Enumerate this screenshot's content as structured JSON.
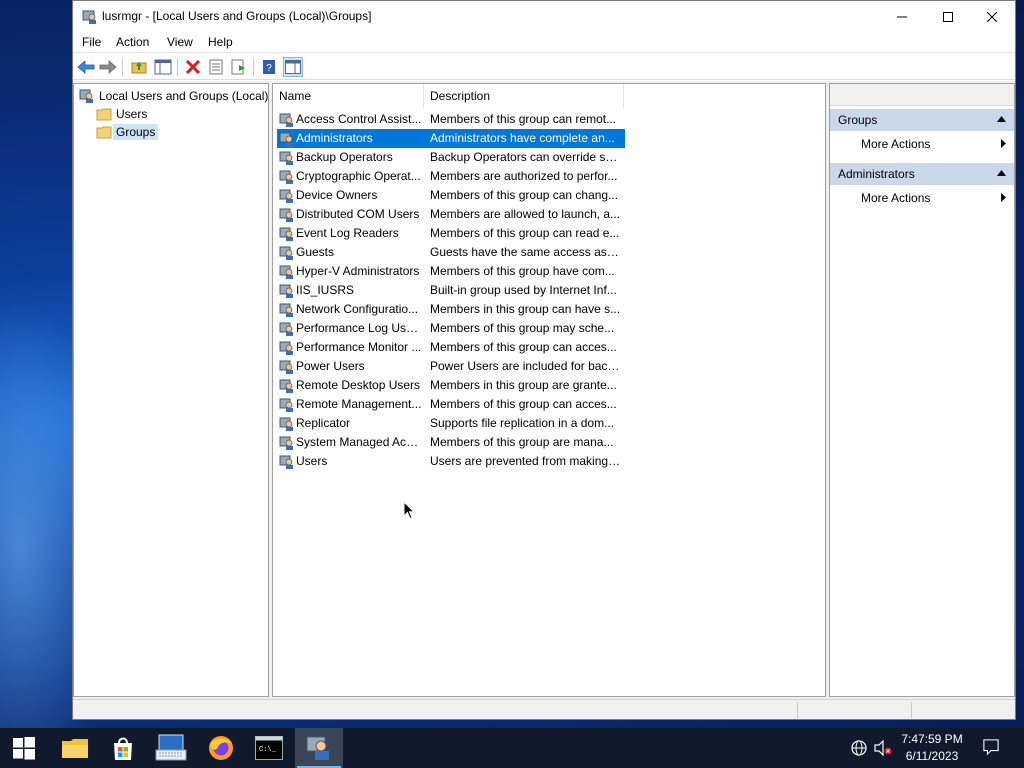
{
  "window": {
    "title": "lusrmgr - [Local Users and Groups (Local)\\Groups]"
  },
  "menu": [
    "File",
    "Action",
    "Help",
    "View"
  ],
  "menu_labels": {
    "file": "File",
    "action": "Action",
    "view": "View",
    "help": "Help"
  },
  "tree": {
    "root": "Local Users and Groups (Local)",
    "users": "Users",
    "groups": "Groups"
  },
  "list": {
    "columns": {
      "name": "Name",
      "description": "Description"
    },
    "rows": [
      {
        "name": "Access Control Assist...",
        "description": "Members of this group can remot..."
      },
      {
        "name": "Administrators",
        "description": "Administrators have complete an..."
      },
      {
        "name": "Backup Operators",
        "description": "Backup Operators can override se..."
      },
      {
        "name": "Cryptographic Operat...",
        "description": "Members are authorized to perfor..."
      },
      {
        "name": "Device Owners",
        "description": "Members of this group can chang..."
      },
      {
        "name": "Distributed COM Users",
        "description": "Members are allowed to launch, a..."
      },
      {
        "name": "Event Log Readers",
        "description": "Members of this group can read e..."
      },
      {
        "name": "Guests",
        "description": "Guests have the same access as m..."
      },
      {
        "name": "Hyper-V Administrators",
        "description": "Members of this group have com..."
      },
      {
        "name": "IIS_IUSRS",
        "description": "Built-in group used by Internet Inf..."
      },
      {
        "name": "Network Configuratio...",
        "description": "Members in this group can have s..."
      },
      {
        "name": "Performance Log Users",
        "description": "Members of this group may sche..."
      },
      {
        "name": "Performance Monitor ...",
        "description": "Members of this group can acces..."
      },
      {
        "name": "Power Users",
        "description": "Power Users are included for back..."
      },
      {
        "name": "Remote Desktop Users",
        "description": "Members in this group are grante..."
      },
      {
        "name": "Remote Management...",
        "description": "Members of this group can acces..."
      },
      {
        "name": "Replicator",
        "description": "Supports file replication in a dom..."
      },
      {
        "name": "System Managed Acc...",
        "description": "Members of this group are mana..."
      },
      {
        "name": "Users",
        "description": "Users are prevented from making ..."
      }
    ],
    "selected_index": 1
  },
  "actions": {
    "groups_header": "Groups",
    "groups_more": "More Actions",
    "admins_header": "Administrators",
    "admins_more": "More Actions"
  },
  "taskbar": {
    "time": "7:47:59 PM",
    "date": "6/11/2023"
  },
  "colors": {
    "selection": "#0078d7",
    "action_header": "#c9d9ea",
    "taskbar": "#101a2c"
  },
  "icons": [
    "start-icon",
    "file-explorer-icon",
    "store-icon",
    "keyboard-icon",
    "firefox-icon",
    "cmd-icon",
    "lusrmgr-icon",
    "network-icon",
    "volume-muted-icon",
    "notification-icon"
  ]
}
